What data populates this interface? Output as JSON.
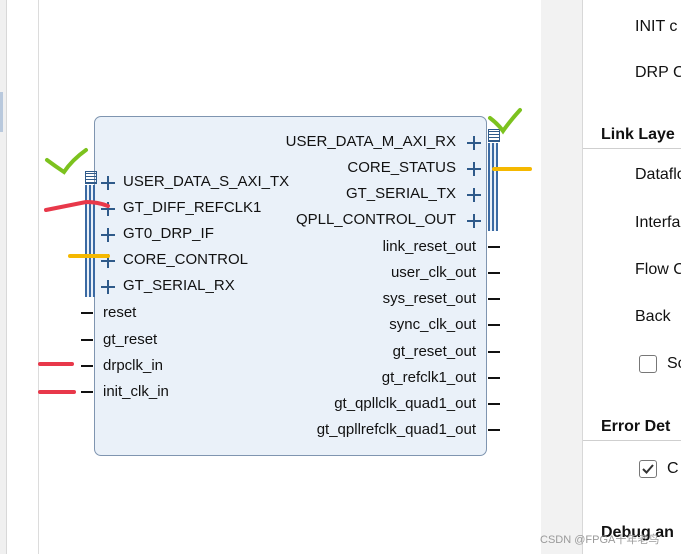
{
  "ip_block": {
    "left_ports": {
      "bus": [
        "USER_DATA_S_AXI_TX",
        "GT_DIFF_REFCLK1",
        "GT0_DRP_IF",
        "CORE_CONTROL",
        "GT_SERIAL_RX"
      ],
      "wire": [
        "reset",
        "gt_reset",
        "drpclk_in",
        "init_clk_in"
      ]
    },
    "right_ports": {
      "bus": [
        "USER_DATA_M_AXI_RX",
        "CORE_STATUS",
        "GT_SERIAL_TX",
        "QPLL_CONTROL_OUT"
      ],
      "wire": [
        "link_reset_out",
        "user_clk_out",
        "sys_reset_out",
        "sync_clk_out",
        "gt_reset_out",
        "gt_refclk1_out",
        "gt_qpllclk_quad1_out",
        "gt_qpllrefclk_quad1_out"
      ]
    }
  },
  "properties": {
    "rows_top": [
      "INIT c",
      "DRP C"
    ],
    "link_layer_title": "Link Laye",
    "link_layer_rows": [
      "Dataflo",
      "Interfa",
      "Flow C",
      "Back"
    ],
    "link_checkbox_label": "Sc",
    "error_title": "Error Det",
    "error_checkbox_label": "C",
    "debug_title": "Debug an"
  },
  "annotations": {
    "colors": {
      "check": "#7cc21e",
      "red": "#e8384a",
      "orange": "#f5b800"
    }
  },
  "watermark": "CSDN @FPGA十年老鸟"
}
